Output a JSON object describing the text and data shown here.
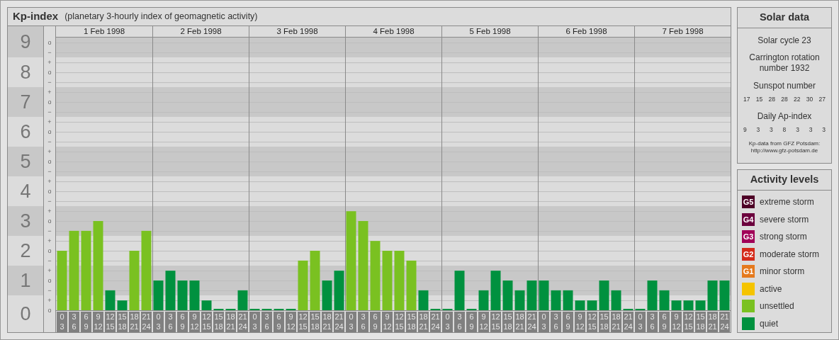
{
  "header": {
    "title": "Kp-index",
    "subtitle": "(planetary 3-hourly index of geomagnetic activity)"
  },
  "kp_chart": {
    "days": [
      "1 Feb 1998",
      "2 Feb 1998",
      "3 Feb 1998",
      "4 Feb 1998",
      "5 Feb 1998",
      "6 Feb 1998",
      "7 Feb 1998"
    ],
    "minor_tick_labels": [
      "o",
      "−",
      "+",
      "o",
      "−",
      "+",
      "o",
      "−",
      "+",
      "o",
      "−",
      "+",
      "o",
      "−",
      "+",
      "o",
      "−",
      "+",
      "o",
      "−",
      "+",
      "o",
      "−",
      "+",
      "o",
      "−",
      "+",
      "o"
    ],
    "chart_data": {
      "type": "bar",
      "ylim": [
        0,
        9.17
      ],
      "yticks": [
        0,
        1,
        2,
        3,
        4,
        5,
        6,
        7,
        8,
        9
      ],
      "grid": true,
      "categories": [
        "0 3",
        "3 6",
        "6 9",
        "9 12",
        "12 15",
        "15 18",
        "18 21",
        "21 24",
        "0 3",
        "3 6",
        "6 9",
        "9 12",
        "12 15",
        "15 18",
        "18 21",
        "21 24",
        "0 3",
        "3 6",
        "6 9",
        "9 12",
        "12 15",
        "15 18",
        "18 21",
        "21 24",
        "0 3",
        "3 6",
        "6 9",
        "9 12",
        "12 15",
        "15 18",
        "18 21",
        "21 24",
        "0 3",
        "3 6",
        "6 9",
        "9 12",
        "12 15",
        "15 18",
        "18 21",
        "21 24",
        "0 3",
        "3 6",
        "6 9",
        "9 12",
        "12 15",
        "15 18",
        "18 21",
        "21 24",
        "0 3",
        "3 6",
        "6 9",
        "9 12",
        "12 15",
        "15 18",
        "18 21",
        "21 24"
      ],
      "series": [
        {
          "color": "#00913f",
          "values": [
            null,
            null,
            null,
            null,
            0.67,
            0.33,
            null,
            null,
            1,
            1.33,
            1,
            1,
            0.33,
            0,
            0,
            0.67,
            0,
            0,
            0,
            0,
            null,
            null,
            1,
            1.33,
            null,
            null,
            null,
            null,
            null,
            null,
            0.67,
            0,
            0,
            1.33,
            0,
            0.67,
            1.33,
            1,
            0.67,
            1,
            1,
            0.67,
            0.67,
            0.33,
            0.33,
            1,
            0.67,
            0,
            0,
            1,
            0.67,
            0.33,
            0.33,
            0.33,
            1,
            1
          ]
        },
        {
          "color": "#7ac121",
          "values": [
            2,
            2.67,
            2.67,
            3,
            null,
            null,
            2,
            2.67,
            null,
            null,
            null,
            null,
            null,
            null,
            null,
            null,
            null,
            null,
            null,
            null,
            1.67,
            2,
            null,
            null,
            3.33,
            3,
            2.33,
            2,
            2,
            1.67,
            null,
            null,
            null,
            null,
            null,
            null,
            null,
            null,
            null,
            null,
            null,
            null,
            null,
            null,
            null,
            null,
            null,
            null,
            null,
            null,
            null,
            null,
            null,
            null,
            null,
            null
          ]
        }
      ]
    }
  },
  "solar_data": {
    "title": "Solar data",
    "solar_cycle": "Solar cycle 23",
    "carrington": "Carrington rotation number 1932",
    "sunspot_title": "Sunspot number",
    "sunspot_numbers": [
      "17",
      "15",
      "28",
      "28",
      "22",
      "30",
      "27"
    ],
    "ap_title": "Daily Ap-index",
    "ap_values": [
      "9",
      "3",
      "3",
      "8",
      "3",
      "3",
      "3"
    ],
    "source_lines": [
      "Kp-data from GFZ Potsdam:",
      "http://www.gfz-potsdam.de"
    ]
  },
  "activity_levels": {
    "title": "Activity levels",
    "items": [
      {
        "code": "G5",
        "label": "extreme storm",
        "color": "#4d0026"
      },
      {
        "code": "G4",
        "label": "severe storm",
        "color": "#6b003d"
      },
      {
        "code": "G3",
        "label": "strong storm",
        "color": "#a10058"
      },
      {
        "code": "G2",
        "label": "moderate storm",
        "color": "#d42a1a"
      },
      {
        "code": "G1",
        "label": "minor storm",
        "color": "#e5791d"
      },
      {
        "label": "active",
        "color": "#f5c400"
      },
      {
        "label": "unsettled",
        "color": "#7ac121"
      },
      {
        "label": "quiet",
        "color": "#00913f"
      }
    ]
  }
}
